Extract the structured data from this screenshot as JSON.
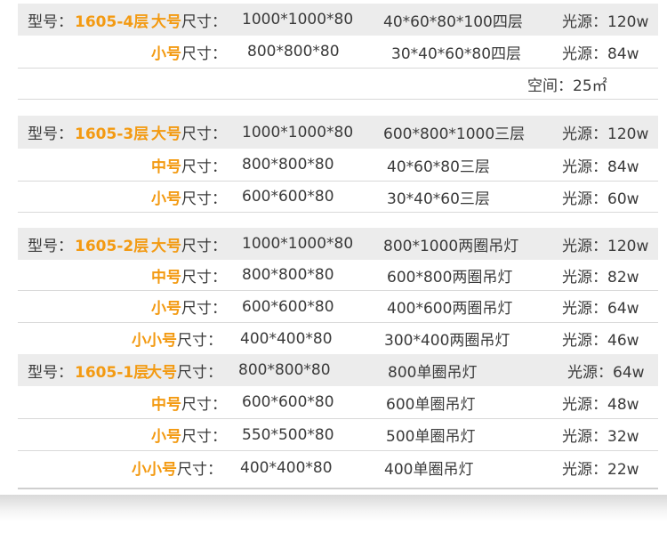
{
  "groups": [
    {
      "model_label": "型号：",
      "model_code": "1605-4层",
      "rows": [
        {
          "size": "大号",
          "size_suffix": "尺寸：",
          "dims": "1000*1000*80",
          "spec": "40*60*80*100四层",
          "light": "光源：120w"
        },
        {
          "size": "小号",
          "size_suffix": "尺寸：",
          "dims": "800*800*80",
          "spec": "30*40*60*80四层",
          "light": "光源：84w"
        }
      ],
      "space": "空间：25㎡"
    },
    {
      "model_label": "型号：",
      "model_code": "1605-3层",
      "rows": [
        {
          "size": "大号",
          "size_suffix": "尺寸：",
          "dims": "1000*1000*80",
          "spec": "600*800*1000三层",
          "light": "光源：120w"
        },
        {
          "size": "中号",
          "size_suffix": "尺寸：",
          "dims": "800*800*80",
          "spec": "40*60*80三层",
          "light": "光源：84w"
        },
        {
          "size": "小号",
          "size_suffix": "尺寸：",
          "dims": "600*600*80",
          "spec": "30*40*60三层",
          "light": "光源：60w"
        }
      ]
    },
    {
      "model_label": "型号：",
      "model_code": "1605-2层",
      "rows": [
        {
          "size": "大号",
          "size_suffix": "尺寸：",
          "dims": "1000*1000*80",
          "spec": "800*1000两圈吊灯",
          "light": "光源：120w"
        },
        {
          "size": "中号",
          "size_suffix": "尺寸：",
          "dims": "800*800*80",
          "spec": "600*800两圈吊灯",
          "light": "光源：82w"
        },
        {
          "size": "小号",
          "size_suffix": "尺寸：",
          "dims": "600*600*80",
          "spec": "400*600两圈吊灯",
          "light": "光源：64w"
        },
        {
          "size": "小小号",
          "size_suffix": "尺寸：",
          "dims": "400*400*80",
          "spec": "300*400两圈吊灯",
          "light": "光源：46w"
        }
      ]
    },
    {
      "model_label": "型号：",
      "model_code": "1605-1层",
      "rows": [
        {
          "size": "大号",
          "size_suffix": "尺寸：",
          "dims": "800*800*80",
          "spec": "800单圈吊灯",
          "light": "光源：64w"
        },
        {
          "size": "中号",
          "size_suffix": "尺寸：",
          "dims": "600*600*80",
          "spec": "600单圈吊灯",
          "light": "光源：48w"
        },
        {
          "size": "小号",
          "size_suffix": "尺寸：",
          "dims": "550*500*80",
          "spec": "500单圈吊灯",
          "light": "光源：32w"
        },
        {
          "size": "小小号",
          "size_suffix": "尺寸：",
          "dims": "400*400*80",
          "spec": "400单圈吊灯",
          "light": "光源：22w"
        }
      ]
    }
  ],
  "colors": {
    "accent": "#f39a12",
    "header_bg": "#ececec",
    "text": "#3a3a3a",
    "divider": "#d9d9d9"
  }
}
